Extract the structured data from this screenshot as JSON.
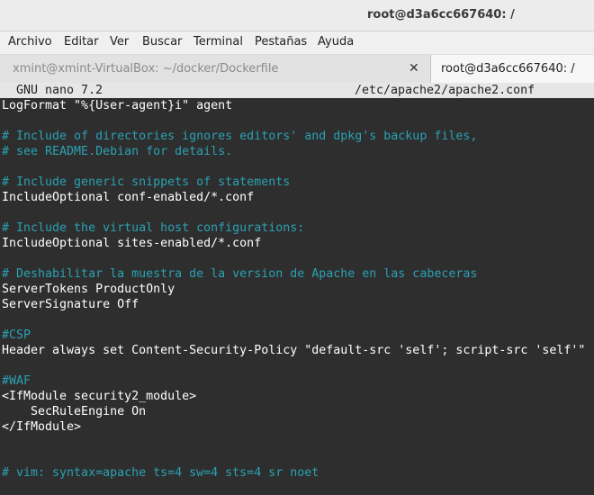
{
  "window": {
    "title": "root@d3a6cc667640: /"
  },
  "menubar": {
    "items": [
      "Archivo",
      "Editar",
      "Ver",
      "Buscar",
      "Terminal",
      "Pestañas",
      "Ayuda"
    ]
  },
  "tabs": [
    {
      "label": "xmint@xmint-VirtualBox: ~/docker/Dockerfile",
      "active": false,
      "close_icon": "close-icon"
    },
    {
      "label": "root@d3a6cc667640: /",
      "active": true
    }
  ],
  "nano": {
    "version": "GNU nano 7.2",
    "file_path": "/etc/apache2/apache2.conf"
  },
  "editor": {
    "lines": [
      {
        "text": "LogFormat \"%{User-agent}i\" agent",
        "type": "code"
      },
      {
        "text": "",
        "type": "code"
      },
      {
        "text": "# Include of directories ignores editors' and dpkg's backup files,",
        "type": "comment"
      },
      {
        "text": "# see README.Debian for details.",
        "type": "comment"
      },
      {
        "text": "",
        "type": "code"
      },
      {
        "text": "# Include generic snippets of statements",
        "type": "comment"
      },
      {
        "text": "IncludeOptional conf-enabled/*.conf",
        "type": "code"
      },
      {
        "text": "",
        "type": "code"
      },
      {
        "text": "# Include the virtual host configurations:",
        "type": "comment"
      },
      {
        "text": "IncludeOptional sites-enabled/*.conf",
        "type": "code"
      },
      {
        "text": "",
        "type": "code"
      },
      {
        "text": "# Deshabilitar la muestra de la version de Apache en las cabeceras",
        "type": "comment"
      },
      {
        "text": "ServerTokens ProductOnly",
        "type": "code"
      },
      {
        "text": "ServerSignature Off",
        "type": "code"
      },
      {
        "text": "",
        "type": "code"
      },
      {
        "text": "#CSP",
        "type": "comment"
      },
      {
        "text": "Header always set Content-Security-Policy \"default-src 'self'; script-src 'self'\"",
        "type": "code"
      },
      {
        "text": "",
        "type": "code"
      },
      {
        "text": "#WAF",
        "type": "comment"
      },
      {
        "text": "<IfModule security2_module>",
        "type": "code"
      },
      {
        "text": "    SecRuleEngine On",
        "type": "code"
      },
      {
        "text": "</IfModule>",
        "type": "code"
      },
      {
        "text": "",
        "type": "code"
      },
      {
        "text": "",
        "type": "code"
      },
      {
        "text": "# vim: syntax=apache ts=4 sw=4 sts=4 sr noet",
        "type": "comment"
      }
    ]
  }
}
